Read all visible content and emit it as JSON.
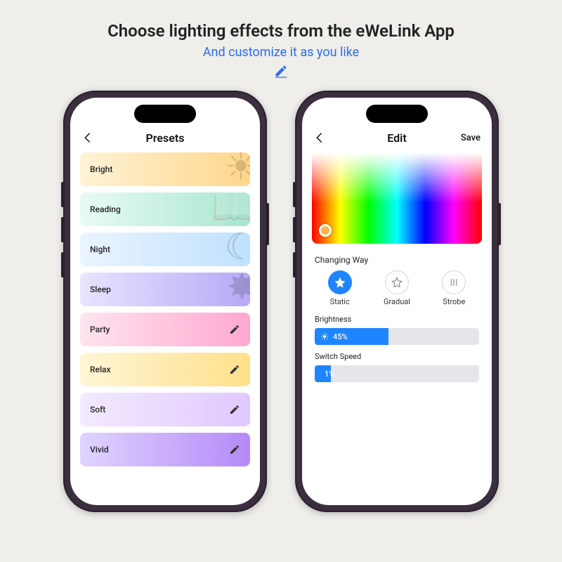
{
  "headline": "Choose lighting effects from the eWeLink App",
  "subhead": "And customize it as you like",
  "left": {
    "title": "Presets",
    "items": [
      {
        "label": "Bright",
        "editable": false
      },
      {
        "label": "Reading",
        "editable": false
      },
      {
        "label": "Night",
        "editable": false
      },
      {
        "label": "Sleep",
        "editable": false
      },
      {
        "label": "Party",
        "editable": true
      },
      {
        "label": "Relax",
        "editable": true
      },
      {
        "label": "Soft",
        "editable": true
      },
      {
        "label": "Vivid",
        "editable": true
      }
    ]
  },
  "right": {
    "title": "Edit",
    "save": "Save",
    "changing_way_label": "Changing Way",
    "modes": [
      {
        "label": "Static",
        "selected": true
      },
      {
        "label": "Gradual",
        "selected": false
      },
      {
        "label": "Strobe",
        "selected": false
      }
    ],
    "brightness": {
      "label": "Brightness",
      "value_pct": 45,
      "display": "45%"
    },
    "switch_speed": {
      "label": "Switch Speed",
      "value_pct": 1,
      "display": "1%"
    }
  },
  "colors": {
    "accent": "#1f85ff"
  }
}
